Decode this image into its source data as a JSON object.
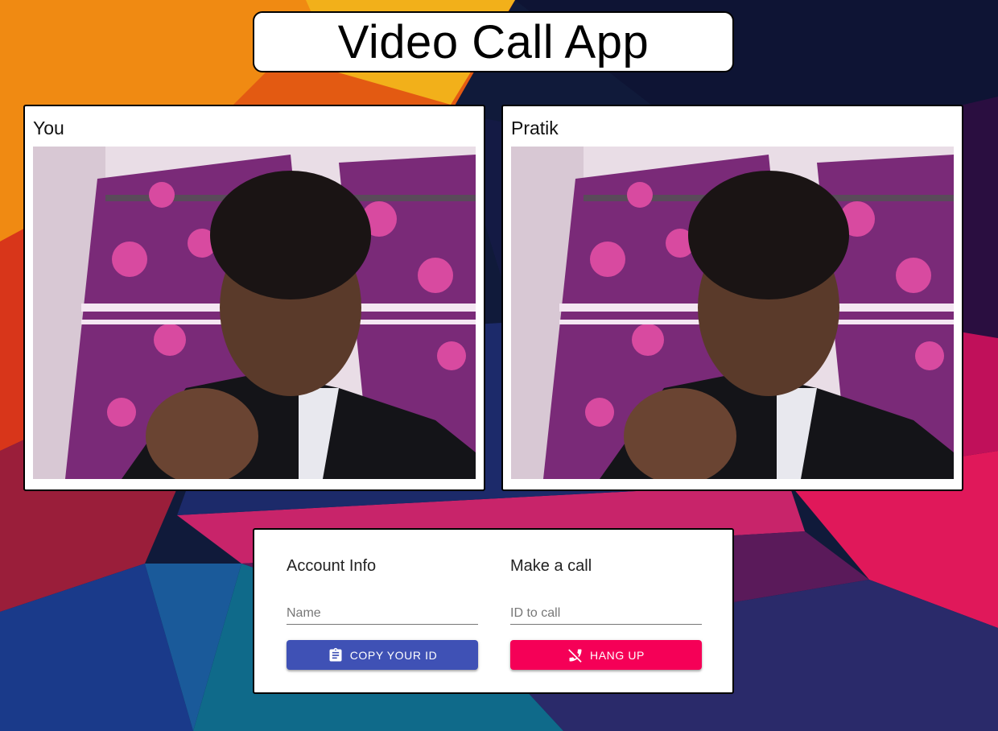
{
  "app": {
    "title": "Video Call App"
  },
  "videos": {
    "local": {
      "label": "You"
    },
    "remote": {
      "label": "Pratik"
    }
  },
  "account": {
    "heading": "Account Info",
    "name_placeholder": "Name",
    "name_value": "",
    "copy_button_label": "COPY YOUR ID",
    "copy_icon": "clipboard-icon",
    "button_color": "#3f51b5"
  },
  "call": {
    "heading": "Make a call",
    "id_placeholder": "ID to call",
    "id_value": "",
    "hangup_button_label": "HANG UP",
    "hangup_icon": "phone-disabled-icon",
    "button_color": "#f50057"
  }
}
